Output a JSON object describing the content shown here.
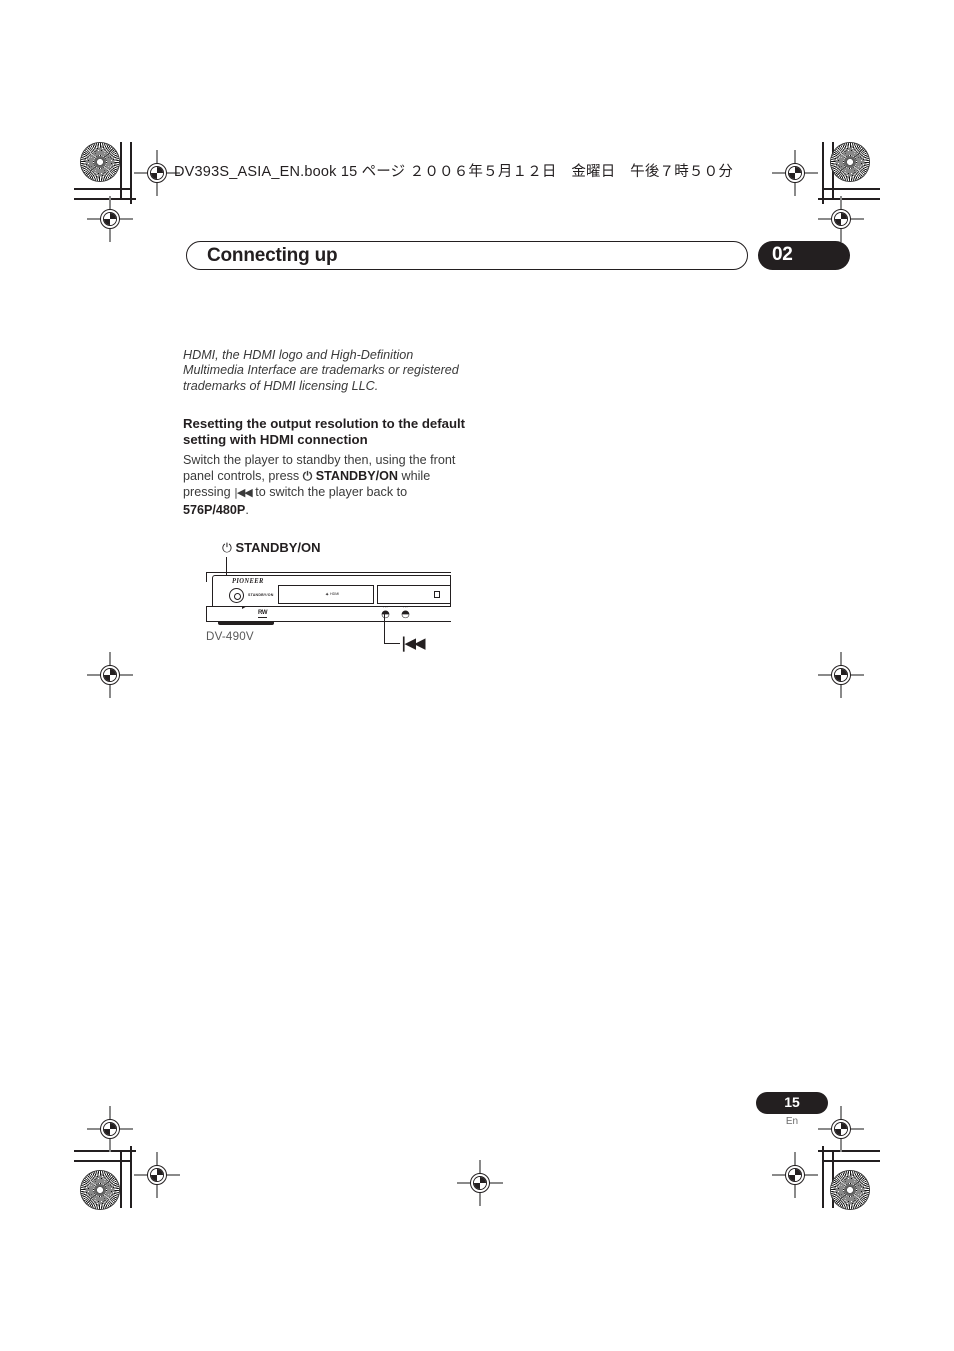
{
  "print_header": {
    "text": "DV393S_ASIA_EN.book 15 ページ ２００６年５月１２日　金曜日　午後７時５０分"
  },
  "chapter": {
    "title": "Connecting up",
    "number": "02"
  },
  "content": {
    "trademark_note": "HDMI, the HDMI logo and High-Definition Multimedia Interface are trademarks or registered trademarks of HDMI licensing LLC.",
    "section_heading": "Resetting the output resolution to the default setting with HDMI connection",
    "instructions_part1": "Switch the player to standby then, using the front panel controls, press ",
    "instructions_power_symbol": "⏻",
    "instructions_standby_bold": "STANDBY/ON",
    "instructions_part2": " while pressing ",
    "instructions_prev_symbol": "|◀◀",
    "instructions_part3": " to switch the player back to ",
    "instructions_resolution_bold": "576P/480P",
    "instructions_part4": "."
  },
  "figure": {
    "callout_power_symbol": "⏻",
    "callout_label": "STANDBY/ON",
    "brand_logo": "PIONEER",
    "standby_button_label": "STANDBY/ON",
    "hdmi_label": "HDMI",
    "hdmi_dot": "✦",
    "rw_label": "RW",
    "mini_button_prev": "◓",
    "mini_button_next": "◓",
    "mini_dots": "···",
    "prev_callout_symbol": "|◀◀",
    "model_label": "DV-490V"
  },
  "footer": {
    "page_number": "15",
    "language": "En"
  }
}
